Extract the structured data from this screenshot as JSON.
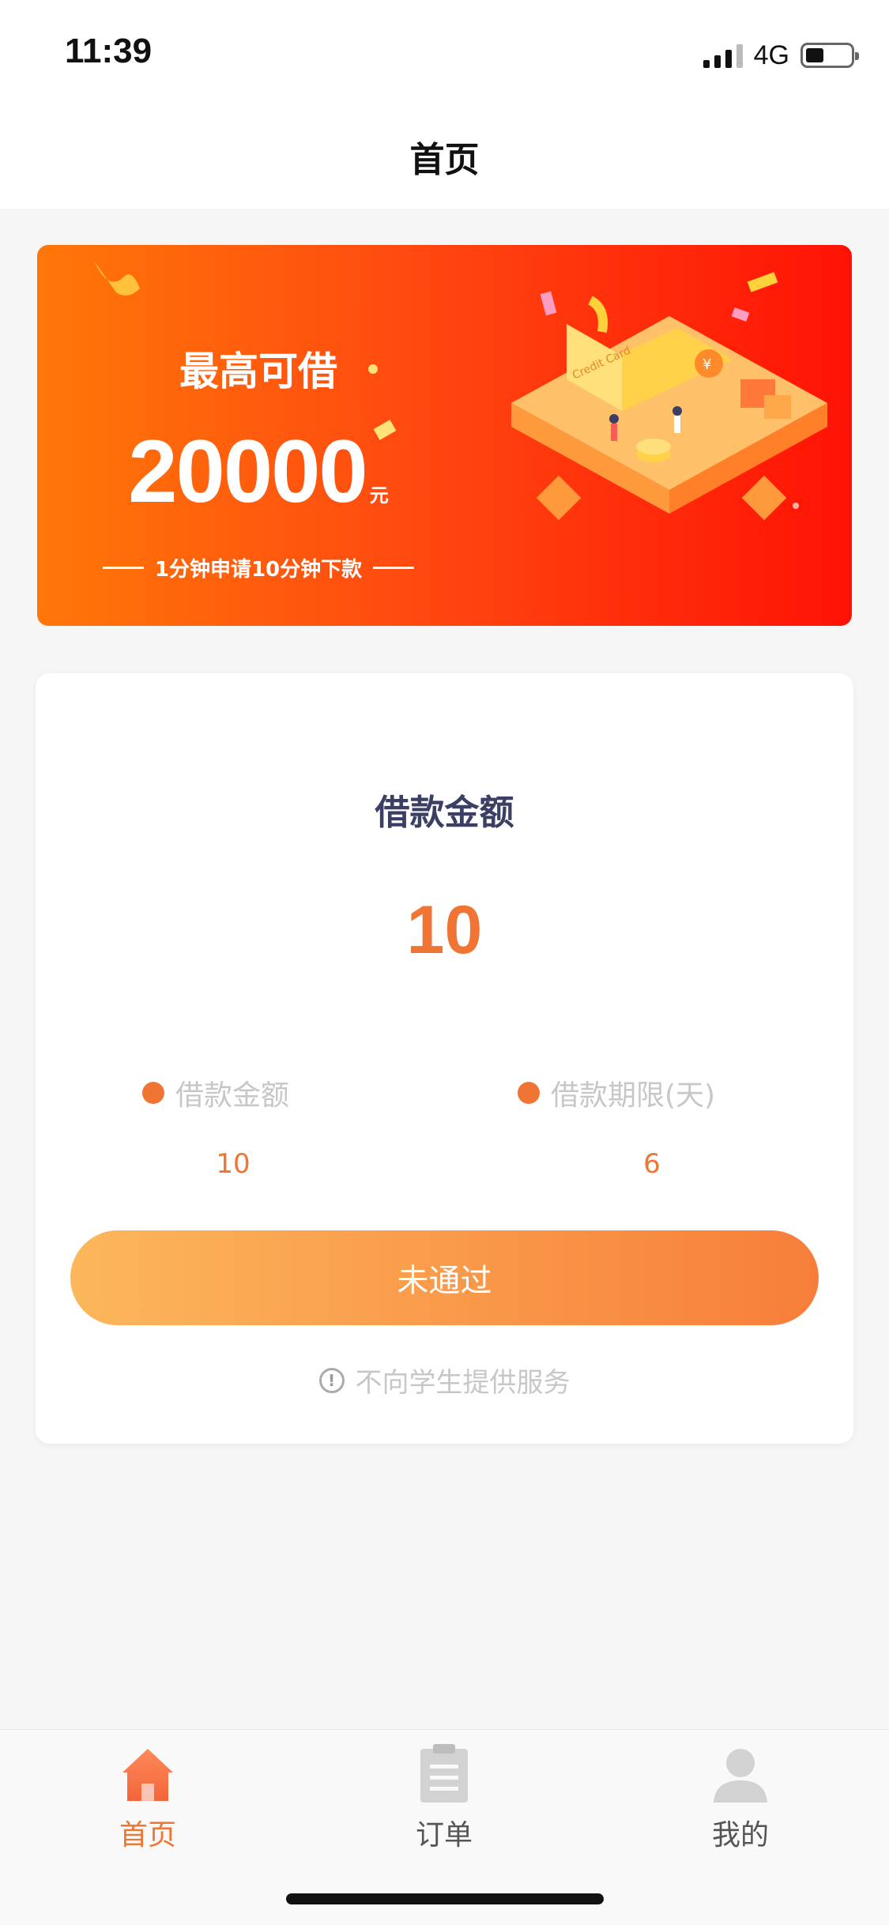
{
  "status_bar": {
    "time": "11:39",
    "network": "4G"
  },
  "nav": {
    "title": "首页"
  },
  "banner": {
    "headline": "最高可借",
    "amount": "20000",
    "unit": "元",
    "subtitle": "1分钟申请10分钟下款",
    "card_text": "Credit Card"
  },
  "loan": {
    "label": "借款金额",
    "amount": "10",
    "details": [
      {
        "label": "借款金额",
        "value": "10"
      },
      {
        "label": "借款期限(天)",
        "value": "6"
      }
    ],
    "button_label": "未通过",
    "notice": "不向学生提供服务"
  },
  "tabs": [
    {
      "label": "首页",
      "icon": "home-icon",
      "active": true
    },
    {
      "label": "订单",
      "icon": "clipboard-icon",
      "active": false
    },
    {
      "label": "我的",
      "icon": "user-icon",
      "active": false
    }
  ],
  "colors": {
    "accent": "#f07434",
    "banner_start": "#ff7708",
    "banner_end": "#ff1205",
    "button_start": "#fcb75b",
    "button_end": "#f77e3a",
    "label_dark": "#3b3f64"
  }
}
